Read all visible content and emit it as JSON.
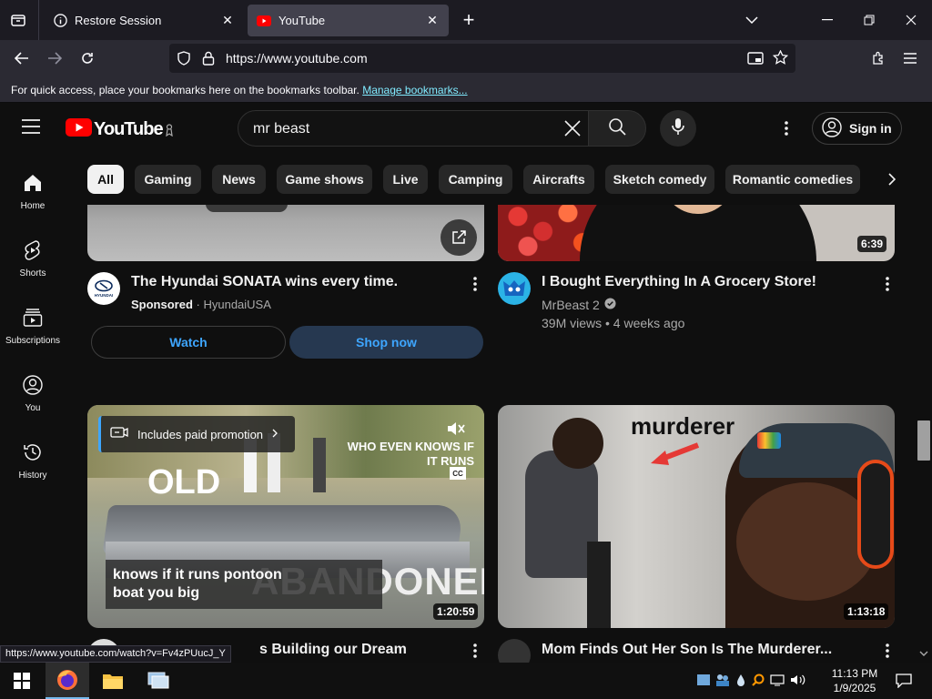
{
  "browser": {
    "tabs": [
      {
        "title": "Restore Session",
        "active": false
      },
      {
        "title": "YouTube",
        "active": true
      }
    ],
    "url": "https://www.youtube.com",
    "bookmarks_message": "For quick access, place your bookmarks here on the bookmarks toolbar.",
    "bookmarks_link": "Manage bookmarks...",
    "status_url": "https://www.youtube.com/watch?v=Fv4zPUucJ_Y"
  },
  "youtube": {
    "logo_text": "YouTube",
    "search_query": "mr beast",
    "sign_in_label": "Sign in",
    "guide": [
      {
        "label": "Home",
        "icon": "home-icon"
      },
      {
        "label": "Shorts",
        "icon": "shorts-icon"
      },
      {
        "label": "Subscriptions",
        "icon": "subscriptions-icon"
      },
      {
        "label": "You",
        "icon": "you-icon"
      },
      {
        "label": "History",
        "icon": "history-icon"
      }
    ],
    "chips": [
      "All",
      "Gaming",
      "News",
      "Game shows",
      "Live",
      "Camping",
      "Aircrafts",
      "Sketch comedy",
      "Romantic comedies"
    ],
    "videos": {
      "ad": {
        "title": "The Hyundai SONATA wins every time.",
        "sponsored": "Sponsored",
        "advertiser": "HyundaiUSA",
        "watch_label": "Watch",
        "shop_label": "Shop now",
        "avatar_text": "HYUNDAI"
      },
      "grocery": {
        "title": "I Bought Everything In A Grocery Store!",
        "channel": "MrBeast 2",
        "meta": "39M views • 4 weeks ago",
        "duration": "6:39"
      },
      "pontoon": {
        "title_partial": "s Building our Dream",
        "duration": "1:20:59",
        "promo": "Includes paid promotion",
        "overlay_line1": "knows if it runs pontoon",
        "overlay_line2": "boat you big",
        "thumb_big_old": "OLD",
        "thumb_big_abandoned": "ABANDONED",
        "thumb_caption": "WHO EVEN KNOWS IF IT RUNS",
        "thumb_cc": "CC"
      },
      "murderer": {
        "title": "Mom Finds Out Her Son Is The Murderer...",
        "duration": "1:13:18",
        "thumb_text": "murderer"
      }
    }
  },
  "taskbar": {
    "time": "11:13 PM",
    "date": "1/9/2025"
  },
  "colors": {
    "yt_red": "#ff0000",
    "yt_bg": "#0f0f0f",
    "link_blue": "#3ea6ff",
    "firefox_active_tab": "#42414d"
  }
}
